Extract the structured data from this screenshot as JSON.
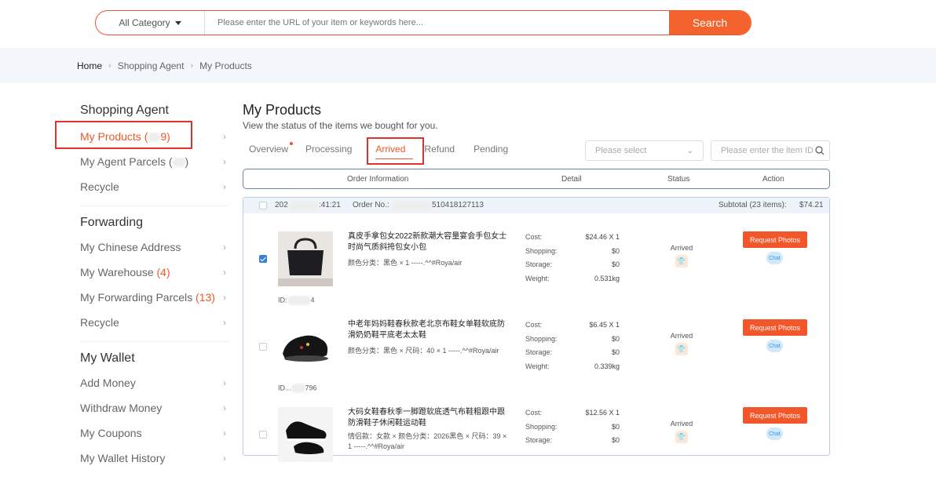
{
  "search": {
    "category": "All Category",
    "placeholder": "Please enter the URL of your item or keywords here...",
    "button": "Search"
  },
  "breadcrumb": [
    "Home",
    "Shopping Agent",
    "My Products"
  ],
  "sidebar": {
    "groups": [
      {
        "title": "Shopping Agent",
        "items": [
          {
            "label": "My Products (",
            "count_suffix": "9)"
          },
          {
            "label": "My Agent Parcels (",
            "count_suffix": ")"
          },
          {
            "label": "Recycle",
            "count_suffix": ""
          }
        ]
      },
      {
        "title": "Forwarding",
        "items": [
          {
            "label": "My Chinese Address",
            "count": ""
          },
          {
            "label": "My Warehouse",
            "count": "(4)"
          },
          {
            "label": "My Forwarding Parcels",
            "count": "(13)"
          },
          {
            "label": "Recycle",
            "count": ""
          }
        ]
      },
      {
        "title": "My Wallet",
        "items": [
          {
            "label": "Add Money"
          },
          {
            "label": "Withdraw Money"
          },
          {
            "label": "My Coupons"
          },
          {
            "label": "My Wallet History"
          }
        ]
      }
    ]
  },
  "main": {
    "title": "My Products",
    "subtitle": "View the status of the items we bought for you.",
    "tabs": [
      "Overview",
      "Processing",
      "Arrived",
      "Refund",
      "Pending"
    ],
    "select_placeholder": "Please select",
    "id_placeholder": "Please enter the item ID",
    "columns": [
      "Order Information",
      "Detail",
      "Status",
      "Action"
    ],
    "order": {
      "date": "202",
      "time": ":41:21",
      "order_label": "Order No.:",
      "order_suffix": "510418127113",
      "subtotal_label": "Subtotal (23 items):",
      "subtotal_value": "$74.21"
    },
    "items": [
      {
        "title": "真皮手拿包女2022新款潮大容量宴会手包女士时尚气质斜挎包女小包",
        "spec": "颜色分类：黑色 × 1 -----.^^#Roya/air",
        "id": "ID:",
        "id_suffix": "4",
        "thumb_caption": "黑色 | sack",
        "cost": "$24.46 X 1",
        "shopping": "$0",
        "storage": "$0",
        "weight": "0.531kg",
        "status": "Arrived",
        "checked": true
      },
      {
        "title": "中老年妈妈鞋春秋款老北京布鞋女单鞋软底防滑奶奶鞋平底老太太鞋",
        "spec": "颜色分类：黑色 × 尺码：40 × 1 -----.^^#Roya/air",
        "id": "ID...",
        "id_suffix": "796",
        "thumb_caption": "",
        "cost": "$6.45 X 1",
        "shopping": "$0",
        "storage": "$0",
        "weight": "0.339kg",
        "status": "Arrived",
        "checked": false
      },
      {
        "title": "大码女鞋春秋季一脚蹬软底透气布鞋粗跟中跟防滑鞋子休闲鞋运动鞋",
        "spec": "情侣款：女款 × 颜色分类：2026黑色 × 尺码：39 × 1 -----.^^#Roya/air",
        "id": "",
        "id_suffix": "",
        "thumb_caption": "",
        "cost": "$12.56 X 1",
        "shopping": "$0",
        "storage": "$0",
        "weight": "",
        "status": "Arrived",
        "checked": false
      }
    ],
    "labels": {
      "cost": "Cost:",
      "shopping": "Shopping:",
      "storage": "Storage:",
      "weight": "Weight:"
    },
    "action_button": "Request Photos",
    "chat_label": "Chat"
  },
  "colors": {
    "accent": "#f4622e",
    "highlight_box": "#e0312b",
    "link_blue": "#3a7ed8"
  }
}
